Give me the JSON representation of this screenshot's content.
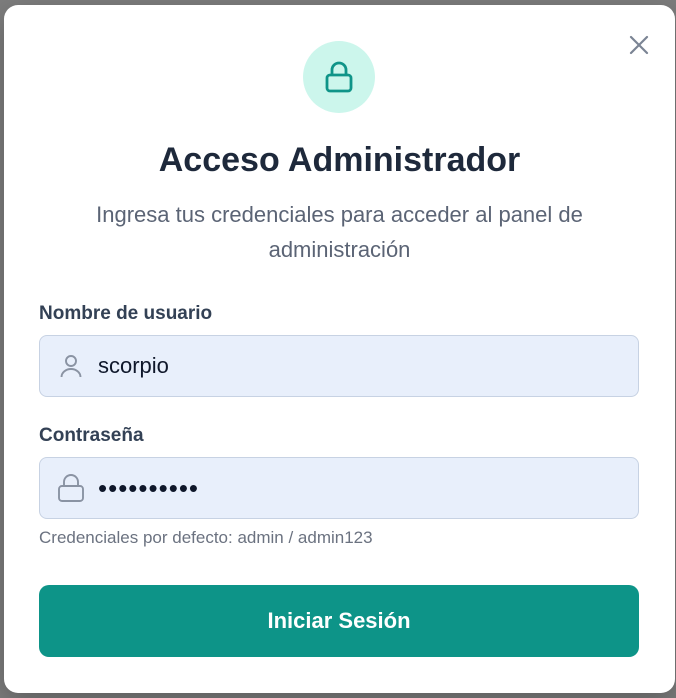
{
  "modal": {
    "title": "Acceso Administrador",
    "subtitle": "Ingresa tus credenciales para acceder al panel de administración"
  },
  "form": {
    "username_label": "Nombre de usuario",
    "username_value": "scorpio",
    "password_label": "Contraseña",
    "password_value": "scorpio123",
    "hint": "Credenciales por defecto: admin / admin123",
    "submit_label": "Iniciar Sesión"
  },
  "icons": {
    "header": "lock-icon",
    "close": "close-icon",
    "username": "user-icon",
    "password": "lock-icon"
  },
  "colors": {
    "accent": "#0d9488",
    "icon_bg": "#ccf6ec",
    "field_bg": "#e8effb",
    "title": "#1e293b"
  }
}
